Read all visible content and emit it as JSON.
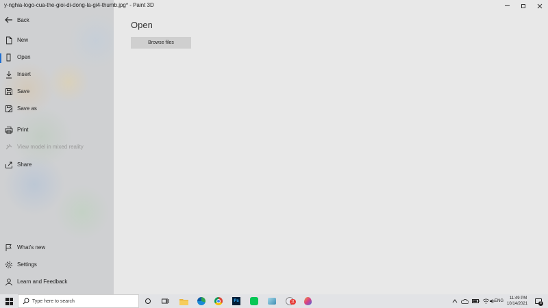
{
  "window": {
    "title": "y-nghia-logo-cua-the-gioi-di-dong-la-gi4-thumb.jpg* - Paint 3D"
  },
  "sidebar": {
    "back_label": "Back",
    "items": [
      {
        "label": "New",
        "icon": "new-file-icon"
      },
      {
        "label": "Open",
        "icon": "open-file-icon",
        "selected": true
      },
      {
        "label": "Insert",
        "icon": "insert-icon"
      },
      {
        "label": "Save",
        "icon": "save-icon"
      },
      {
        "label": "Save as",
        "icon": "save-as-icon"
      },
      {
        "label": "Print",
        "icon": "print-icon"
      },
      {
        "label": "View model in mixed reality",
        "icon": "mixed-reality-icon",
        "disabled": true
      },
      {
        "label": "Share",
        "icon": "share-icon"
      }
    ],
    "bottom_items": [
      {
        "label": "What's new",
        "icon": "flag-icon"
      },
      {
        "label": "Settings",
        "icon": "gear-icon"
      },
      {
        "label": "Learn and Feedback",
        "icon": "person-icon"
      }
    ]
  },
  "main": {
    "title": "Open",
    "browse_button": "Browse files"
  },
  "taskbar": {
    "search_placeholder": "Type here to search",
    "language": "ENG",
    "time": "11:49 PM",
    "date": "10/14/2021",
    "notification_count": "5",
    "badge_count": "11"
  },
  "colors": {
    "accent": "#1f6fd1",
    "taskbar": "#e2e3e6"
  }
}
